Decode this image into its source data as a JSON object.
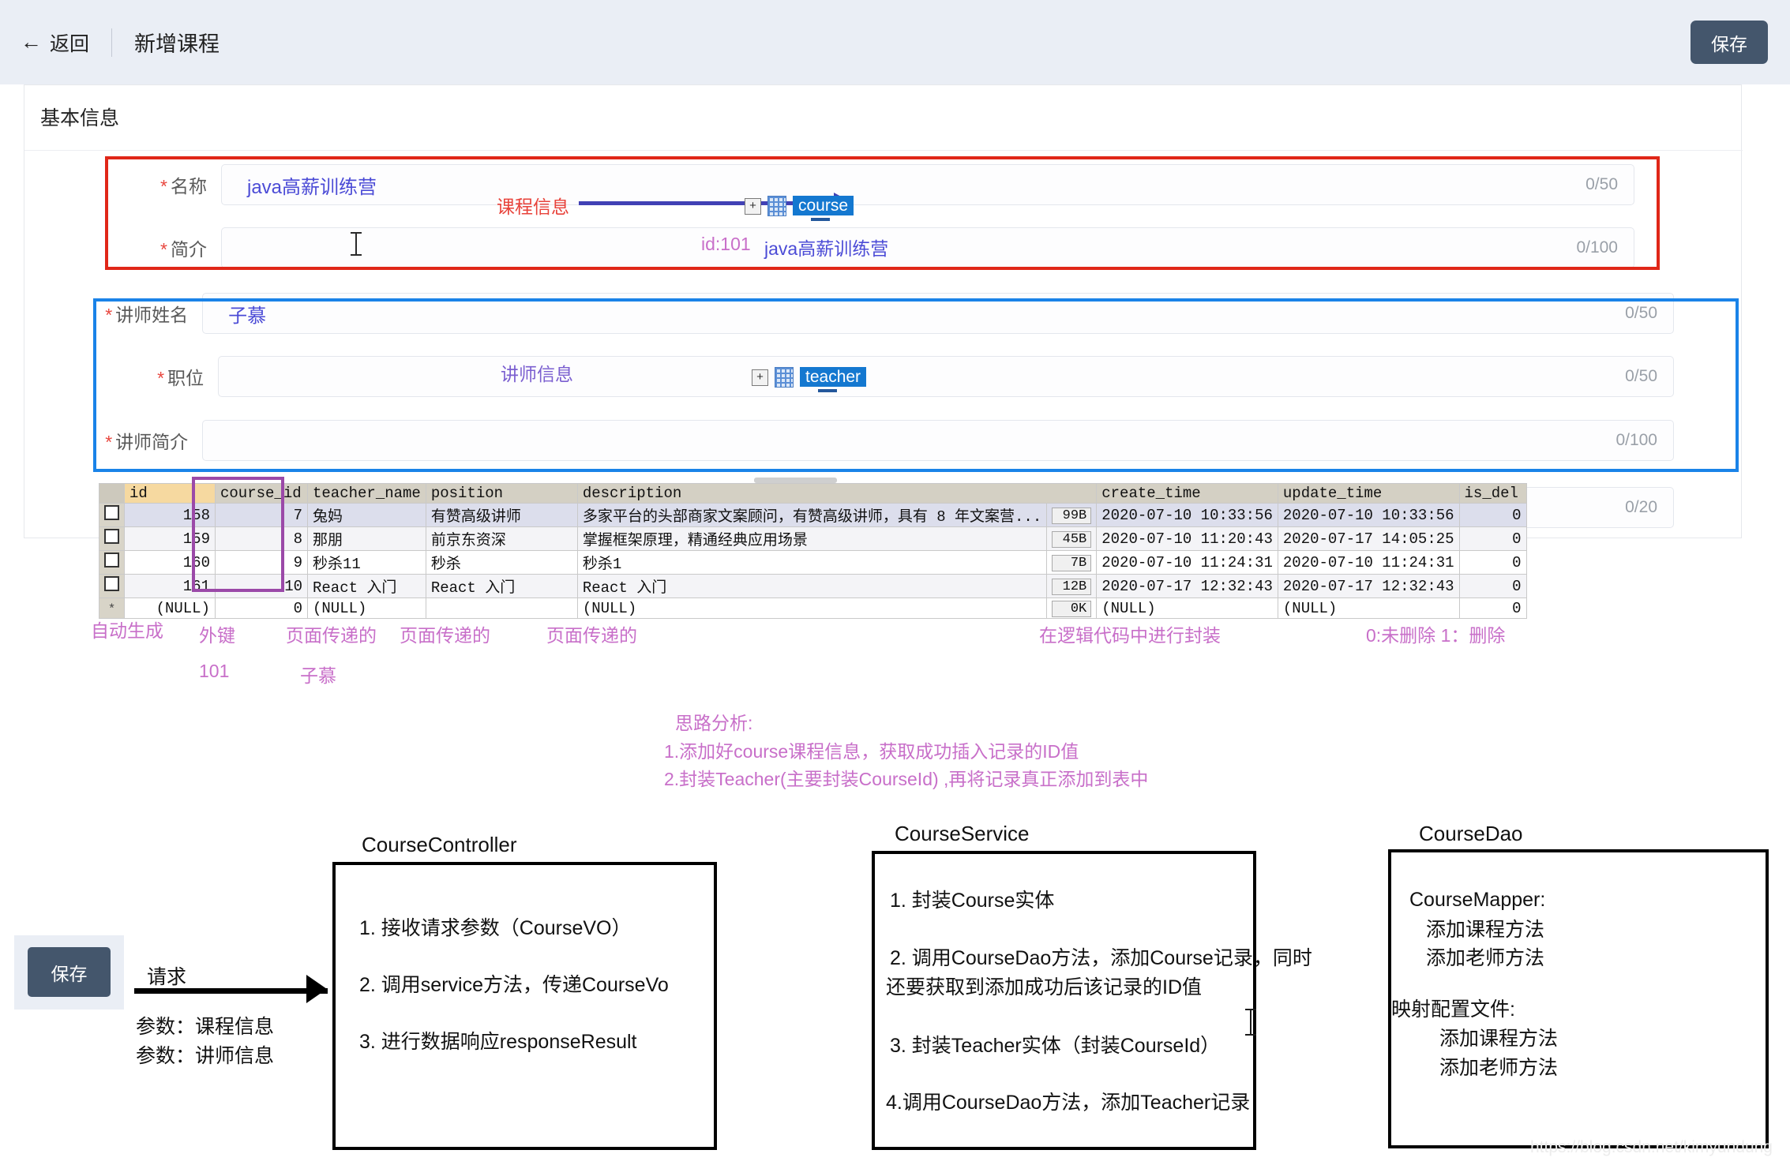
{
  "appbar": {
    "back_label": "返回",
    "back_icon": "arrow-left-icon",
    "title": "新增课程",
    "save_label": "保存"
  },
  "card": {
    "section_title": "基本信息",
    "fields": [
      {
        "label": "名称",
        "required": true,
        "value": "java高薪训练营",
        "counter": "0/50"
      },
      {
        "label": "简介",
        "required": true,
        "value": "",
        "counter": "0/100"
      },
      {
        "label": "讲师姓名",
        "required": true,
        "value": "子慕",
        "counter": "0/50"
      },
      {
        "label": "职位",
        "required": true,
        "value": "",
        "counter": "0/50"
      },
      {
        "label": "讲师简介",
        "required": true,
        "value": "",
        "counter": "0/100"
      },
      {
        "label": "",
        "required": false,
        "value": "",
        "counter": "0/20"
      }
    ]
  },
  "annotations": {
    "course_info": "课程信息",
    "course_tag": "course",
    "course_id_note": "id:101",
    "course_name_note": "java高薪训练营",
    "teacher_info": "讲师信息",
    "teacher_tag": "teacher",
    "colors": {
      "course_box": "#e02718",
      "teacher_box": "#1a83e8",
      "course_col_box": "#9b49a8",
      "arrow": "#4141b5",
      "pink_note": "#c86fc9",
      "red_note": "#e8423a",
      "purple_note": "#7b5fd0",
      "accent": "#44566c"
    },
    "column_notes": [
      {
        "text": "自动生成",
        "sub": ""
      },
      {
        "text": "外键",
        "sub": "101"
      },
      {
        "text": "页面传递的",
        "sub": "子慕"
      },
      {
        "text": "页面传递的",
        "sub": ""
      },
      {
        "text": "页面传递的",
        "sub": ""
      },
      {
        "text": "在逻辑代码中进行封装",
        "sub": ""
      },
      {
        "text": "0:未删除  1：删除",
        "sub": ""
      }
    ],
    "analysis": [
      "思路分析:",
      "1.添加好course课程信息，获取成功插入记录的ID值",
      "2.封装Teacher(主要封装CourseId) ,再将记录真正添加到表中"
    ]
  },
  "db_table": {
    "columns": [
      "",
      "id",
      "course_id",
      "teacher_name",
      "position",
      "description",
      "",
      "create_time",
      "update_time",
      "is_del"
    ],
    "rows": [
      {
        "id": "158",
        "course_id": "7",
        "teacher_name": "兔妈",
        "position": "有赞高级讲师",
        "description": "多家平台的头部商家文案顾问，有赞高级讲师，具有 8 年文案营...",
        "size": "99B",
        "create_time": "2020-07-10 10:33:56",
        "update_time": "2020-07-10 10:33:56",
        "is_del": "0"
      },
      {
        "id": "159",
        "course_id": "8",
        "teacher_name": "那朋",
        "position": "前京东资深",
        "description": "掌握框架原理，精通经典应用场景",
        "size": "45B",
        "create_time": "2020-07-10 11:20:43",
        "update_time": "2020-07-17 14:05:25",
        "is_del": "0"
      },
      {
        "id": "160",
        "course_id": "9",
        "teacher_name": "秒杀11",
        "position": "秒杀",
        "description": "秒杀1",
        "size": "7B",
        "create_time": "2020-07-10 11:24:31",
        "update_time": "2020-07-10 11:24:31",
        "is_del": "0"
      },
      {
        "id": "161",
        "course_id": "10",
        "teacher_name": "React 入门",
        "position": "React 入门",
        "description": "React 入门",
        "size": "12B",
        "create_time": "2020-07-17 12:32:43",
        "update_time": "2020-07-17 12:32:43",
        "is_del": "0"
      },
      {
        "id": "(NULL)",
        "course_id": "0",
        "teacher_name": "(NULL)",
        "position": "",
        "description": "(NULL)",
        "size": "0K",
        "create_time": "(NULL)",
        "update_time": "(NULL)",
        "is_del": "0"
      }
    ]
  },
  "diagram": {
    "trigger": {
      "button_label": "保存",
      "edge_label": "请求",
      "params": [
        "参数：课程信息",
        "参数：讲师信息"
      ]
    },
    "boxes": [
      {
        "title": "CourseController",
        "lines": [
          "1. 接收请求参数（CourseVO）",
          "2. 调用service方法，传递CourseVo",
          "3. 进行数据响应responseResult"
        ]
      },
      {
        "title": "CourseService",
        "lines": [
          "1. 封装Course实体",
          "2. 调用CourseDao方法，添加Course记录，同时",
          "还要获取到添加成功后该记录的ID值",
          "3. 封装Teacher实体（封装CourseId）",
          "4.调用CourseDao方法，添加Teacher记录"
        ]
      },
      {
        "title": "CourseDao",
        "lines": [
          "CourseMapper:",
          "添加课程方法",
          "添加老师方法",
          "映射配置文件:",
          "添加课程方法",
          "添加老师方法"
        ]
      }
    ]
  },
  "watermark": "https://blog.csdn.net/kimyundung"
}
